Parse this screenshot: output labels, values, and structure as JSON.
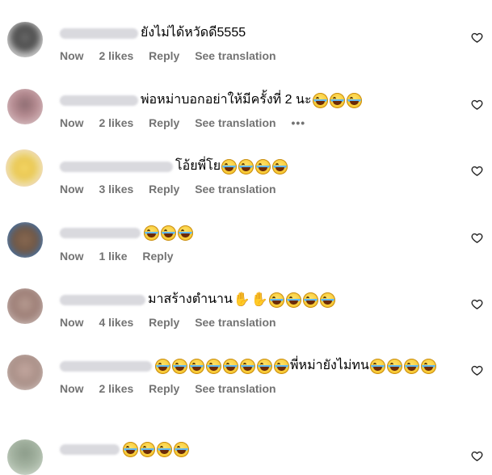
{
  "meta_labels": {
    "reply": "Reply",
    "see_translation": "See translation",
    "more": "•••"
  },
  "comments": [
    {
      "time": "Now",
      "likes": "2 likes",
      "text": "ยังไม่ได้หวัดดี5555",
      "username_hidden": true
    },
    {
      "time": "Now",
      "likes": "2 likes",
      "text": "พ่อหม่าบอกอย่าให้มีครั้งที่ 2 นะ",
      "username_hidden": true,
      "emojis": [
        "laugh",
        "laugh",
        "laugh"
      ]
    },
    {
      "time": "Now",
      "likes": "3 likes",
      "text": "โอ้ยพี่โย",
      "username_hidden": true,
      "emojis": [
        "laugh",
        "laugh",
        "laugh",
        "laugh"
      ]
    },
    {
      "time": "Now",
      "likes": "1 like",
      "text": "",
      "username_hidden": true,
      "emojis": [
        "laugh",
        "laugh",
        "laugh"
      ]
    },
    {
      "time": "Now",
      "likes": "4 likes",
      "text": "มาสร้างตำนาน",
      "username_hidden": true,
      "emojis": [
        "clap",
        "clap",
        "laugh",
        "laugh",
        "laugh",
        "laugh"
      ]
    },
    {
      "time": "Now",
      "likes": "2 likes",
      "text": "พี่หม่ายังไม่ทน",
      "username_hidden": true,
      "emojis_before": 8,
      "emojis_after": 4
    },
    {
      "time": "",
      "likes": "",
      "text": "",
      "username_hidden": true,
      "emojis": [
        "laugh",
        "laugh",
        "laugh",
        "laugh"
      ]
    }
  ],
  "colors": {
    "meta": "#737373",
    "background": "#ffffff"
  },
  "icons": {
    "like": "heart-outline-icon",
    "clap": "clapping-hands-icon",
    "laugh": "tears-of-joy-icon"
  }
}
